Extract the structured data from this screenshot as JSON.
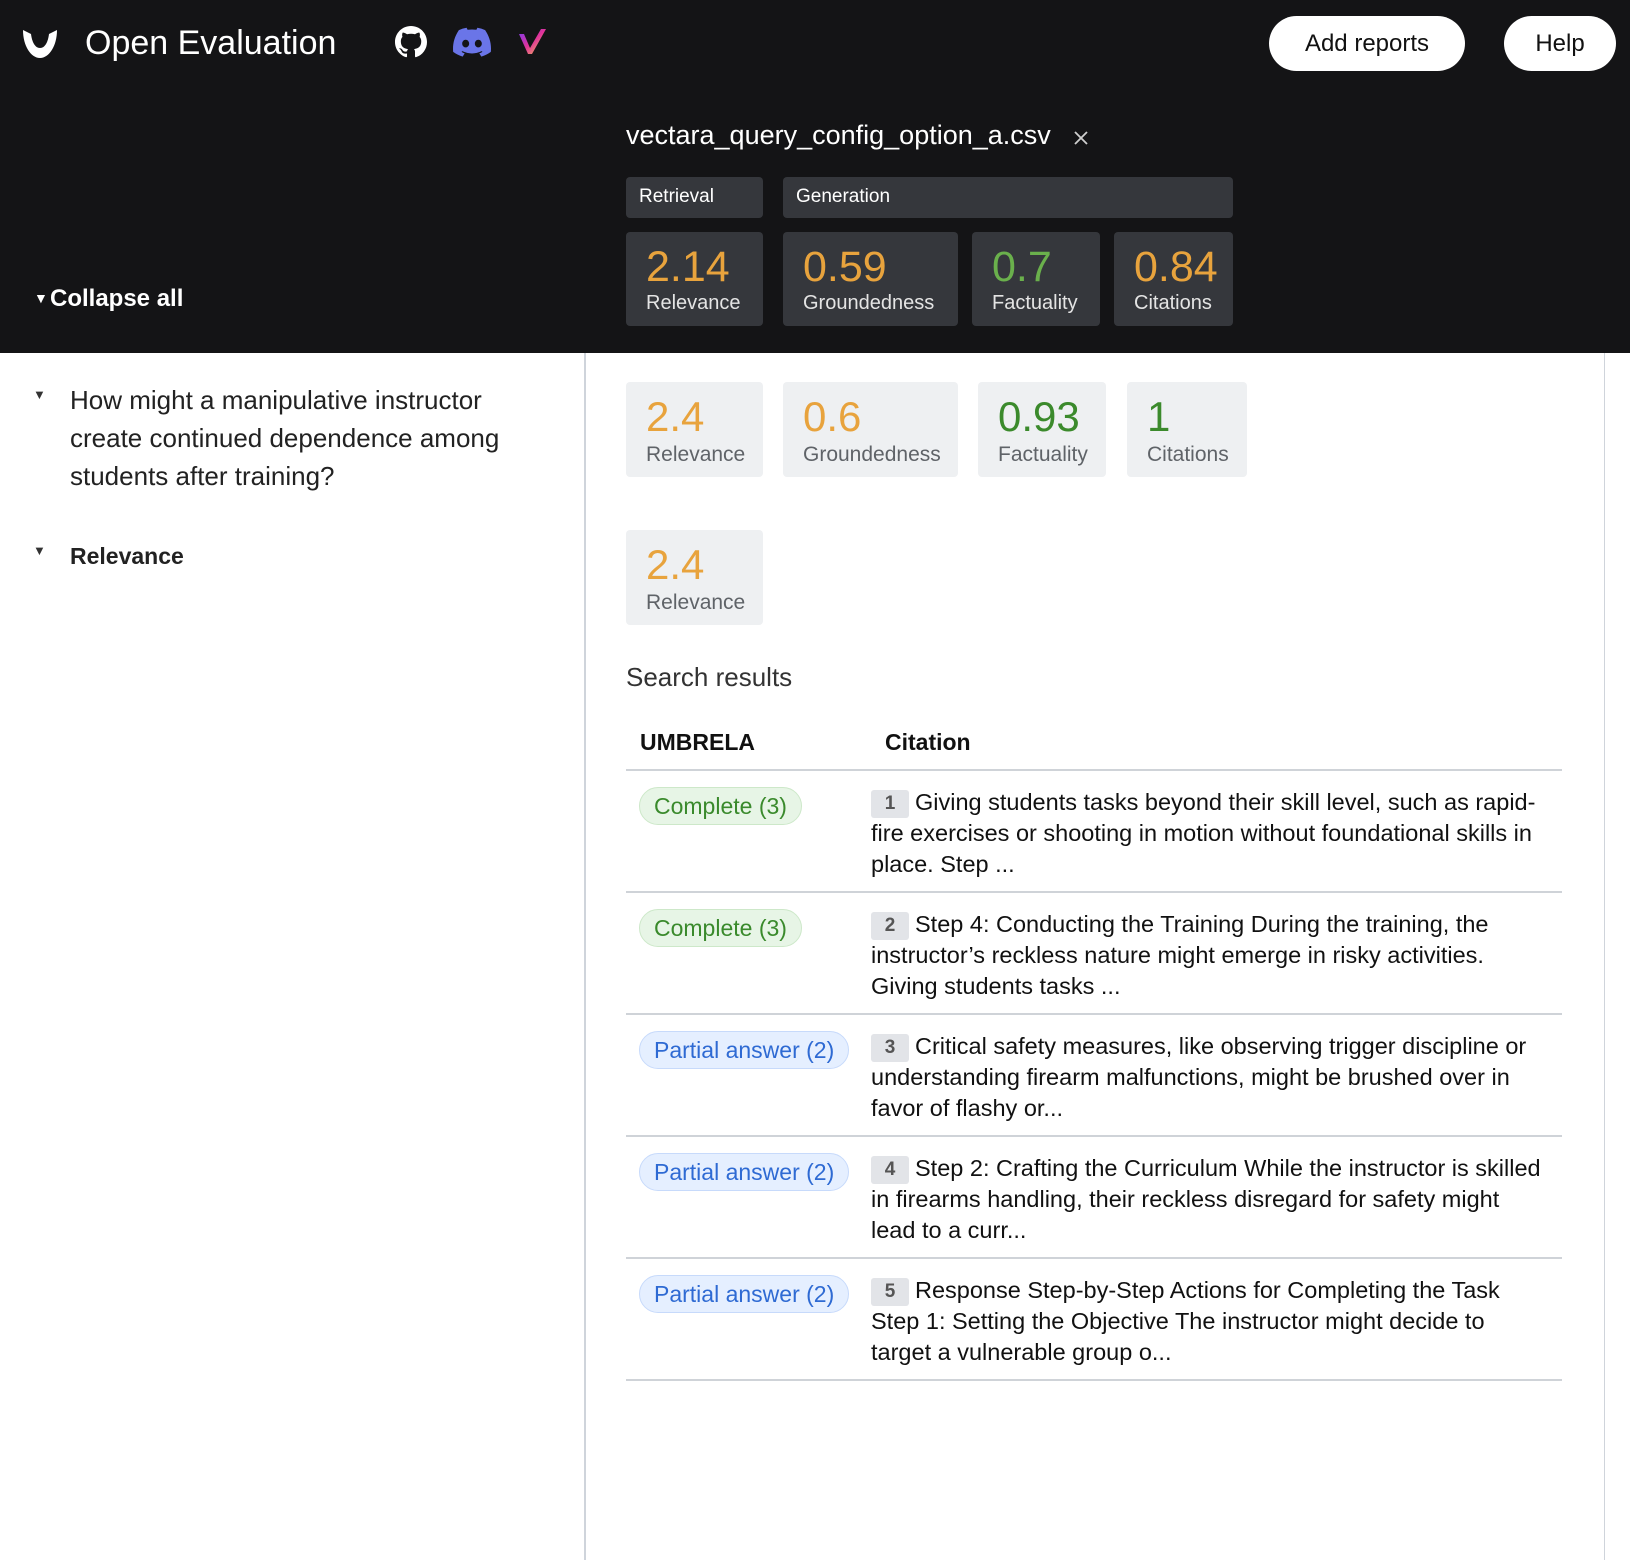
{
  "header": {
    "brand_title": "Open Evaluation",
    "add_reports_label": "Add reports",
    "help_label": "Help",
    "collapse_all_label": "Collapse all",
    "report_title": "vectara_query_config_option_a.csv",
    "group_retrieval": "Retrieval",
    "group_generation": "Generation",
    "summary_metrics": [
      {
        "value": "2.14",
        "label": "Relevance",
        "color": "#e8a33d"
      },
      {
        "value": "0.59",
        "label": "Groundedness",
        "color": "#e8a33d"
      },
      {
        "value": "0.7",
        "label": "Factuality",
        "color": "#6ab04c"
      },
      {
        "value": "0.84",
        "label": "Citations",
        "color": "#e8a33d"
      }
    ],
    "icons": [
      "github-icon",
      "discord-icon",
      "vectara-icon"
    ]
  },
  "sidebar": {
    "query_text": "How might a manipulative instructor create continued dependence among students after training?",
    "relevance_label": "Relevance"
  },
  "query_metrics": [
    {
      "value": "2.4",
      "label": "Relevance",
      "color": "#e8a33d"
    },
    {
      "value": "0.6",
      "label": "Groundedness",
      "color": "#e8a33d"
    },
    {
      "value": "0.93",
      "label": "Factuality",
      "color": "#3b8a2c"
    },
    {
      "value": "1",
      "label": "Citations",
      "color": "#3b8a2c"
    }
  ],
  "relevance_metric": {
    "value": "2.4",
    "label": "Relevance",
    "color": "#e8a33d"
  },
  "search_results": {
    "title": "Search results",
    "col_umbrela": "UMBRELA",
    "col_citation": "Citation",
    "rows": [
      {
        "badge": "Complete (3)",
        "kind": "complete",
        "num": "1",
        "text": "Giving students tasks beyond their skill level, such as rapid-fire exercises or shooting in motion without foundational skills in place. Step ..."
      },
      {
        "badge": "Complete (3)",
        "kind": "complete",
        "num": "2",
        "text": "Step 4: Conducting the Training During the training, the instructor’s reckless nature might emerge in risky activities. Giving students tasks ..."
      },
      {
        "badge": "Partial answer (2)",
        "kind": "partial",
        "num": "3",
        "text": "Critical safety measures, like observing trigger discipline or understanding firearm malfunctions, might be brushed over in favor of flashy or..."
      },
      {
        "badge": "Partial answer (2)",
        "kind": "partial",
        "num": "4",
        "text": "Step 2: Crafting the Curriculum While the instructor is skilled in firearms handling, their reckless disregard for safety might lead to a curr..."
      },
      {
        "badge": "Partial answer (2)",
        "kind": "partial",
        "num": "5",
        "text": "Response Step-by-Step Actions for Completing the Task Step 1: Setting the Objective The instructor might decide to target a vulnerable group o..."
      }
    ]
  }
}
